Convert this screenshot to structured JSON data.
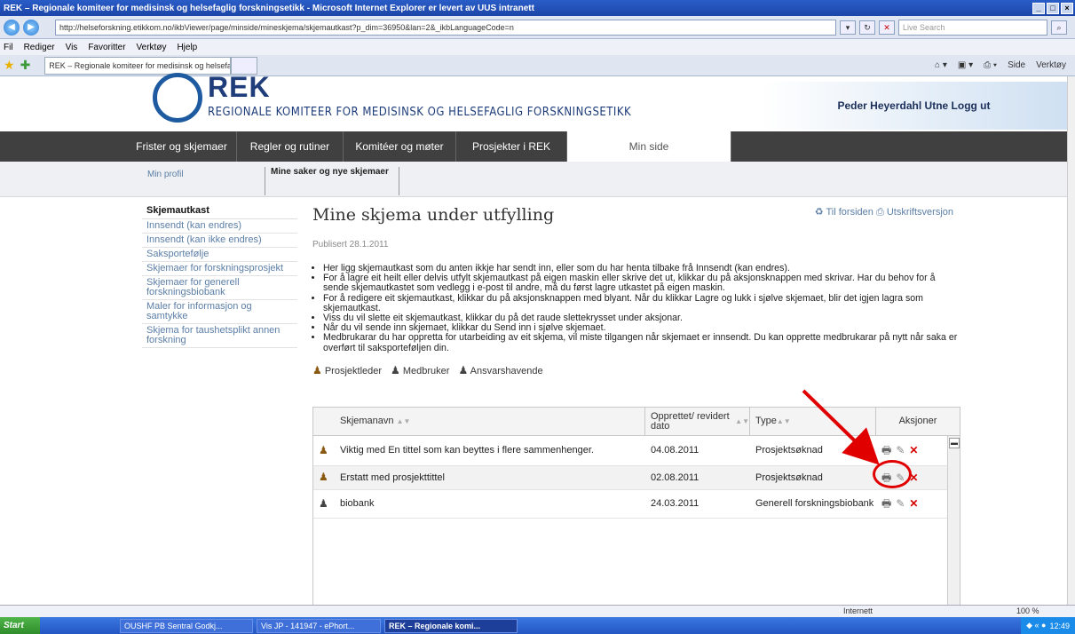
{
  "browser": {
    "title": "REK – Regionale komiteer for medisinsk og helsefaglig forskningsetikk - Microsoft Internet Explorer er levert av UUS intranett",
    "address": "http://helseforskning.etikkom.no/ikbViewer/page/minside/mineskjema/skjemautkast?p_dim=36950&lan=2&_ikbLanguageCode=n",
    "search_placeholder": "Live Search",
    "menu": [
      "Fil",
      "Rediger",
      "Vis",
      "Favoritter",
      "Verktøy",
      "Hjelp"
    ],
    "tab_title": "REK – Regionale komiteer for medisinsk og helsefaglig ...",
    "tools": [
      "Side",
      "Verktøy"
    ],
    "status_zone": "Internett",
    "zoom": "100 %"
  },
  "site": {
    "logo": "REK",
    "logo_sub": "REGIONALE KOMITEER FOR MEDISINSK OG HELSEFAGLIG FORSKNINGSETIKK",
    "user": "Peder Heyerdahl Utne Logg ut",
    "nav": [
      "Frister og skjemaer",
      "Regler og rutiner",
      "Komitéer og møter",
      "Prosjekter i REK",
      "Min side"
    ],
    "subnav": [
      "Min profil",
      "Mine saker og nye skjemaer"
    ]
  },
  "sidebar": {
    "heading": "Skjemautkast",
    "items": [
      "Innsendt (kan endres)",
      "Innsendt (kan ikke endres)",
      "Saksportefølje",
      "Skjemaer for forskningsprosjekt",
      "Skjemaer for generell forskningsbiobank",
      "Maler for informasjon og samtykke",
      "Skjema for taushetsplikt annen forskning"
    ]
  },
  "main": {
    "title": "Mine skjema under utfylling",
    "link_home": "Til forsiden",
    "link_print": "Utskriftsversjon",
    "published": "Publisert 28.1.2011",
    "bullets": [
      "Her ligg skjemautkast som du anten ikkje har sendt inn, eller som du har henta tilbake frå Innsendt (kan endres).",
      "For å lagre eit heilt eller delvis utfylt skjemautkast på eigen maskin eller skrive det ut, klikkar du på aksjonsknappen med skrivar. Har du behov for å sende skjemautkastet som vedlegg i e-post til andre, må du først lagre utkastet på eigen maskin.",
      "For å redigere eit skjemautkast, klikkar du på aksjonsknappen med blyant. Når du klikkar Lagre og lukk i sjølve skjemaet, blir det igjen lagra som skjemautkast.",
      "Viss du vil slette eit skjemautkast, klikkar du på det raude slettekrysset under aksjonar.",
      "Når du vil sende inn skjemaet, klikkar du Send inn i sjølve skjemaet.",
      "Medbrukarar du har oppretta for utarbeiding av eit skjema, vil miste tilgangen når skjemaet er innsendt. Du kan opprette medbrukarar på nytt når saka er overført til saksporteføljen din."
    ],
    "legend": [
      "Prosjektleder",
      "Medbruker",
      "Ansvarshavende"
    ]
  },
  "table": {
    "headers": [
      "Skjemanavn",
      "Opprettet/ revidert dato",
      "Type",
      "Aksjoner"
    ],
    "rows": [
      {
        "name": "Viktig med En tittel som kan beyttes i flere sammenhenger.",
        "date": "04.08.2011",
        "type": "Prosjektsøknad"
      },
      {
        "name": "Erstatt med prosjekttittel",
        "date": "02.08.2011",
        "type": "Prosjektsøknad"
      },
      {
        "name": "biobank",
        "date": "24.03.2011",
        "type": "Generell forskningsbiobank"
      }
    ]
  },
  "taskbar": {
    "start": "Start",
    "tasks": [
      "OUSHF PB Sentral Godkj...",
      "Vis JP - 141947 - ePhort...",
      "REK – Regionale komi..."
    ],
    "clock": "12:49"
  }
}
